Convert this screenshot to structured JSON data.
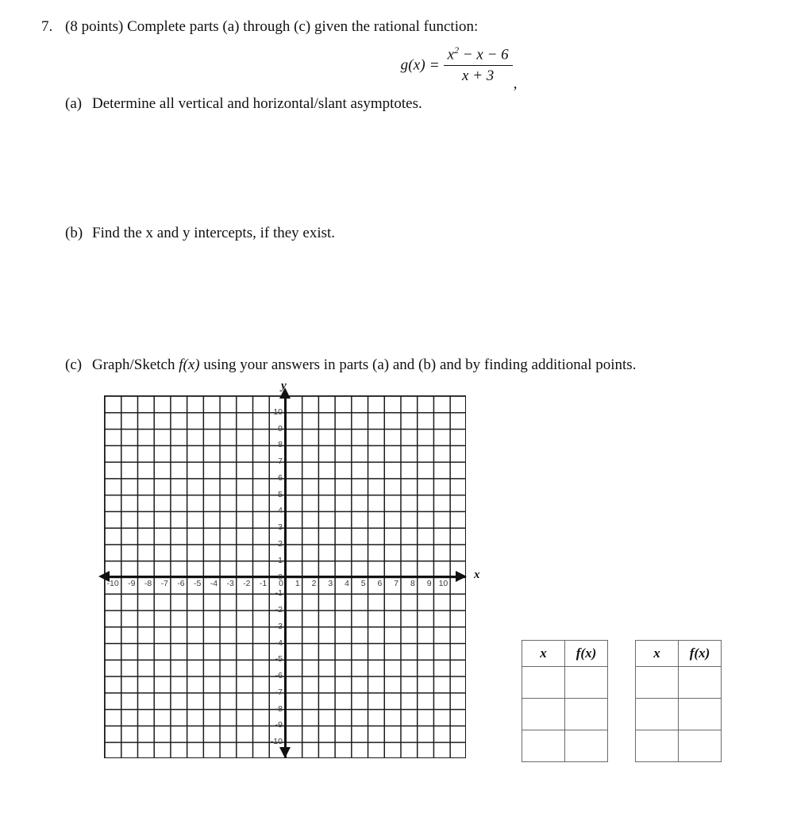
{
  "problem": {
    "number": "7.",
    "stem": "(8 points) Complete parts (a) through (c) given the rational function:",
    "formula": {
      "lhs": "g(x)",
      "equals": "=",
      "numerator_base": "x",
      "numerator_exponent": "2",
      "numerator_rest": " − x − 6",
      "denominator": "x + 3",
      "trailing": ","
    },
    "parts": [
      {
        "tag": "(a)",
        "text": "Determine all vertical and horizontal/slant asymptotes."
      },
      {
        "tag": "(b)",
        "text": "Find the x and y intercepts, if they exist."
      },
      {
        "tag": "(c)",
        "text_before": "Graph/Sketch ",
        "text_math": "f(x)",
        "text_after": " using your answers in parts (a) and (b) and by finding additional points."
      }
    ]
  },
  "graph": {
    "x_axis_label": "x",
    "y_axis_label": "y",
    "x_min": -11,
    "x_max": 11,
    "y_min": -11,
    "y_max": 11,
    "grid_columns": 22,
    "grid_rows": 22,
    "x_tick_labels": [
      "-10",
      "-9",
      "-8",
      "-7",
      "-6",
      "-5",
      "-4",
      "-3",
      "-2",
      "-1",
      "0",
      "1",
      "2",
      "3",
      "4",
      "5",
      "6",
      "7",
      "8",
      "9",
      "10"
    ],
    "y_tick_labels": [
      "10",
      "9",
      "8",
      "7",
      "6",
      "5",
      "4",
      "3",
      "2",
      "1",
      "0",
      "-1",
      "-2",
      "-3",
      "-4",
      "-5",
      "-6",
      "-7",
      "-8",
      "-9",
      "-10"
    ],
    "grid_color": "#1a1a1a",
    "axis_color": "#111111",
    "has_arrows": true,
    "plotted_curve": false
  },
  "tables": [
    {
      "headers": [
        "x",
        "f(x)"
      ],
      "rows": [
        [
          "",
          ""
        ],
        [
          "",
          ""
        ],
        [
          "",
          ""
        ]
      ]
    },
    {
      "headers": [
        "x",
        "f(x)"
      ],
      "rows": [
        [
          "",
          ""
        ],
        [
          "",
          ""
        ],
        [
          "",
          ""
        ]
      ]
    }
  ]
}
